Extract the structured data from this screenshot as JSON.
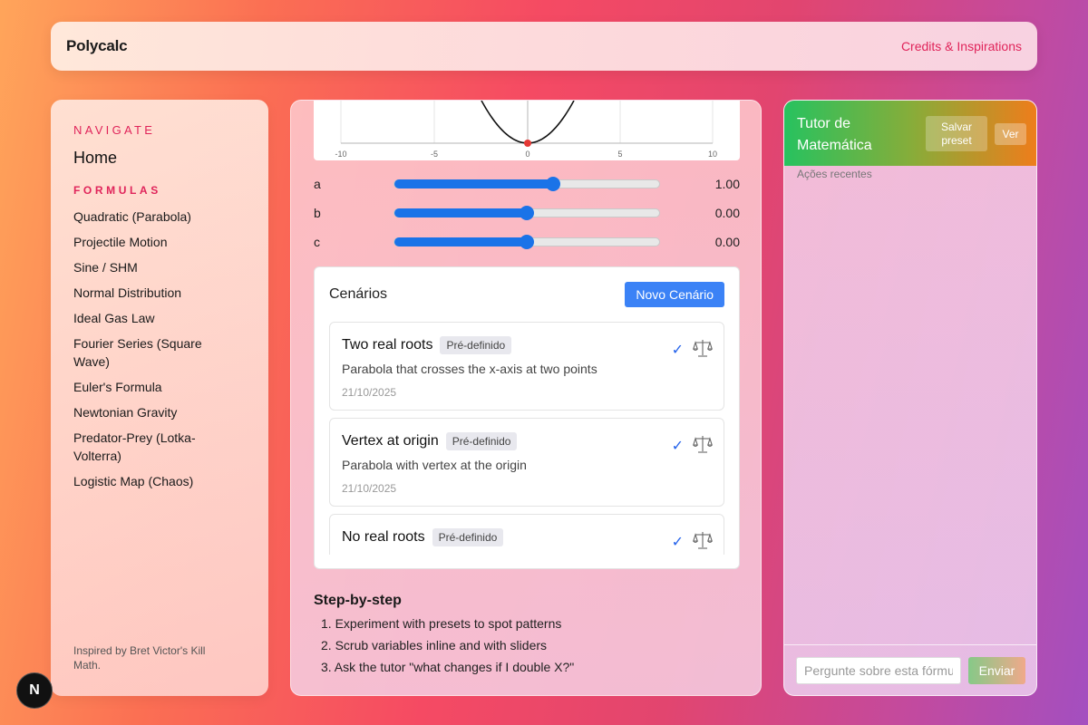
{
  "header": {
    "brand": "Polycalc",
    "credits_link": "Credits & Inspirations"
  },
  "sidebar": {
    "navigate_title": "NAVIGATE",
    "home": "Home",
    "formulas_title": "FORMULAS",
    "formulas": [
      "Quadratic (Parabola)",
      "Projectile Motion",
      "Sine / SHM",
      "Normal Distribution",
      "Ideal Gas Law",
      "Fourier Series (Square Wave)",
      "Euler's Formula",
      "Newtonian Gravity",
      "Predator-Prey (Lotka-Volterra)",
      "Logistic Map (Chaos)"
    ],
    "footer": "Inspired by Bret Victor's Kill Math."
  },
  "graph": {
    "x_ticks": [
      "-10",
      "-5",
      "0",
      "5",
      "10"
    ]
  },
  "sliders": [
    {
      "label": "a",
      "value": "1.00",
      "fraction": 0.6
    },
    {
      "label": "b",
      "value": "0.00",
      "fraction": 0.5
    },
    {
      "label": "c",
      "value": "0.00",
      "fraction": 0.5
    }
  ],
  "scenarios": {
    "title": "Cenários",
    "new_button": "Novo Cenário",
    "items": [
      {
        "title": "Two real roots",
        "badge": "Pré-definido",
        "description": "Parabola that crosses the x-axis at two points",
        "date": "21/10/2025"
      },
      {
        "title": "Vertex at origin",
        "badge": "Pré-definido",
        "description": "Parabola with vertex at the origin",
        "date": "21/10/2025"
      },
      {
        "title": "No real roots",
        "badge": "Pré-definido",
        "description": "",
        "date": ""
      }
    ]
  },
  "steps": {
    "title": "Step-by-step",
    "items": [
      "1. Experiment with presets to spot patterns",
      "2. Scrub variables inline and with sliders",
      "3. Ask the tutor \"what changes if I double X?\""
    ]
  },
  "tutor": {
    "title": "Tutor de Matemática",
    "save_preset": "Salvar preset",
    "view": "Ver",
    "recent": "Ações recentes",
    "input_placeholder": "Pergunte sobre esta fórmula",
    "send": "Enviar"
  },
  "nextjs_badge": "N",
  "colors": {
    "accent": "#e0245a",
    "primary": "#3b82f6",
    "slider": "#1a73e8"
  }
}
